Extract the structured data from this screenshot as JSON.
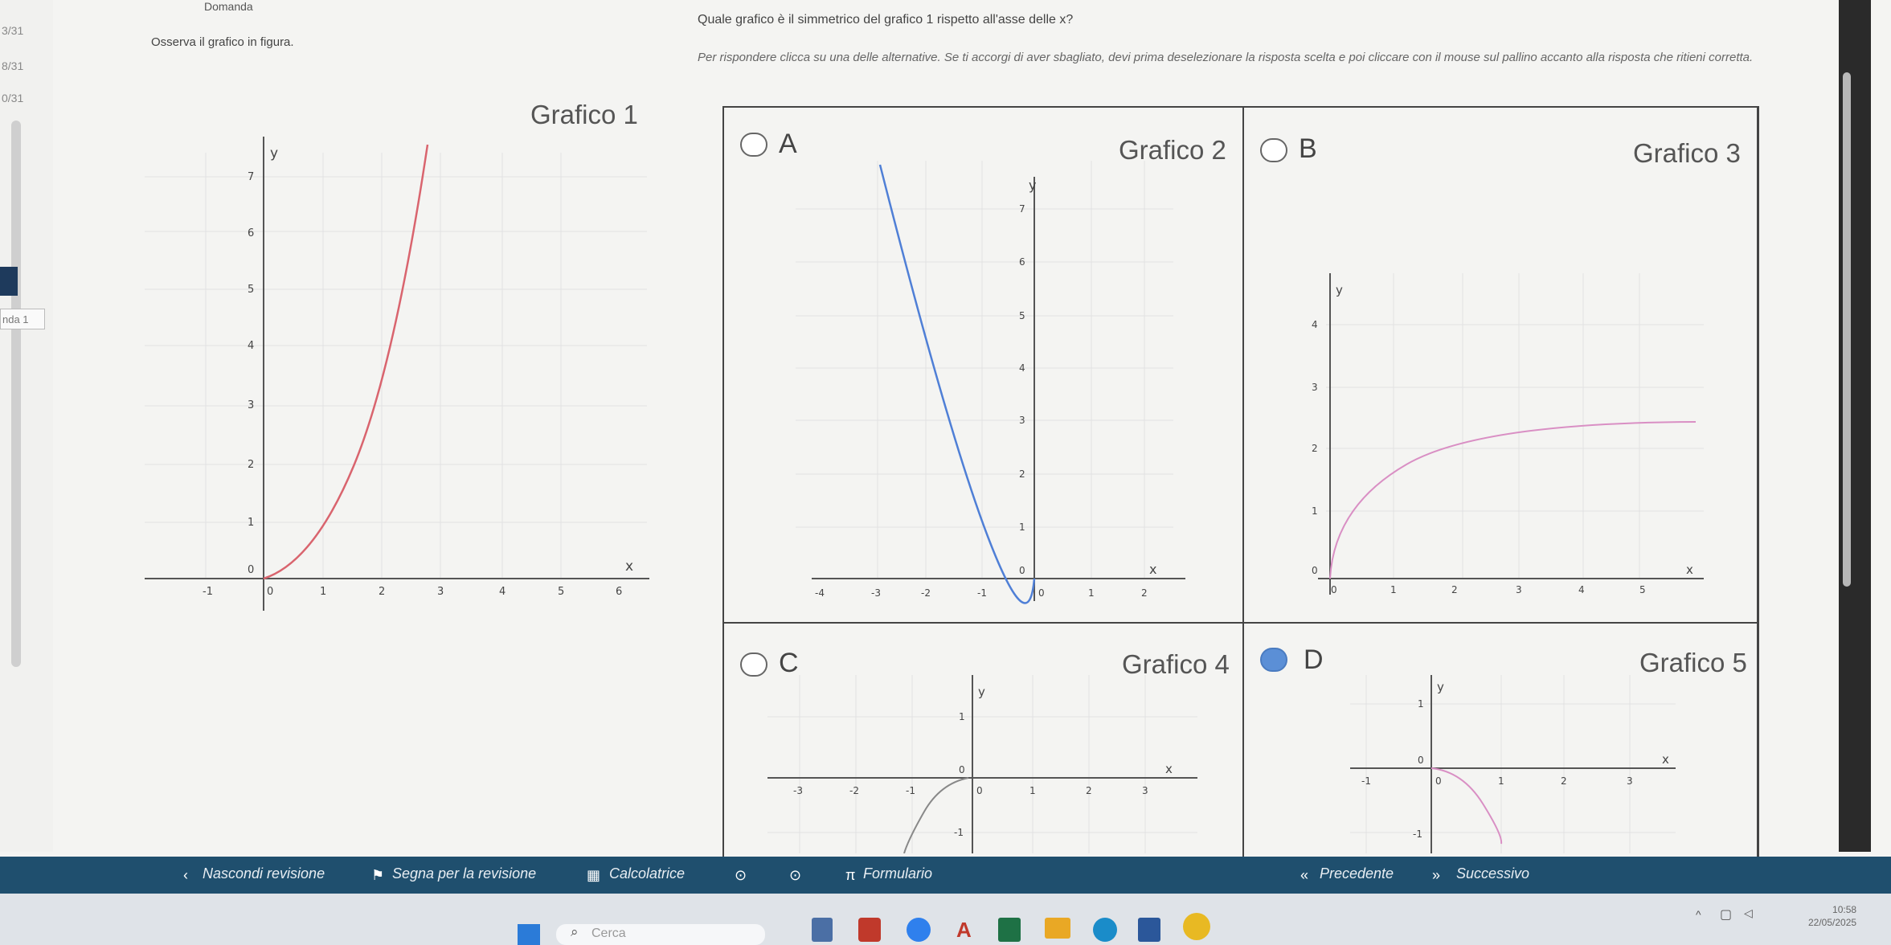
{
  "sidebar": {
    "counters": [
      "3/31",
      "8/31",
      "0/31"
    ],
    "side_label": "nda 1"
  },
  "header": {
    "label": "Domanda",
    "question": "Quale grafico è il simmetrico del grafico 1 rispetto all'asse delle x?",
    "instruction": "Per rispondere clicca su una delle alternative. Se ti accorgi di aver sbagliato, devi prima deselezionare la risposta scelta e poi cliccare con il mouse sul pallino accanto alla risposta che ritieni corretta.",
    "prompt": "Osserva il grafico in figura."
  },
  "figures": {
    "grafico1": "Grafico 1",
    "grafico2": "Grafico 2",
    "grafico3": "Grafico 3",
    "grafico4": "Grafico 4",
    "grafico5": "Grafico 5"
  },
  "options": [
    {
      "letter": "A",
      "selected": false
    },
    {
      "letter": "B",
      "selected": false
    },
    {
      "letter": "C",
      "selected": false
    },
    {
      "letter": "D",
      "selected": true
    }
  ],
  "axis": {
    "x": "x",
    "y": "y"
  },
  "ticks": {
    "g1_x": [
      "-1",
      "0",
      "1",
      "2",
      "3",
      "4",
      "5",
      "6"
    ],
    "g1_y": [
      "7",
      "6",
      "5",
      "4",
      "3",
      "2",
      "1",
      "0"
    ],
    "g2_x": [
      "-4",
      "-3",
      "-2",
      "-1",
      "0",
      "1",
      "2"
    ],
    "g2_y": [
      "7",
      "6",
      "5",
      "4",
      "3",
      "2",
      "1",
      "0"
    ],
    "g3_x": [
      "0",
      "1",
      "2",
      "3",
      "4",
      "5"
    ],
    "g3_y": [
      "4",
      "3",
      "2",
      "1",
      "0"
    ],
    "g4_x": [
      "-3",
      "-2",
      "-1",
      "0",
      "1",
      "2",
      "3"
    ],
    "g4_y": [
      "1",
      "0",
      "-1"
    ],
    "g5_x": [
      "-1",
      "0",
      "1",
      "2",
      "3"
    ],
    "g5_y": [
      "1",
      "0",
      "-1"
    ]
  },
  "toolbar": {
    "hide_review": "Nascondi revisione",
    "mark_review": "Segna per la revisione",
    "calculator": "Calcolatrice",
    "formulas": "Formulario",
    "previous": "Precedente",
    "next": "Successivo"
  },
  "taskbar": {
    "search_placeholder": "Cerca",
    "time": "10:58",
    "date": "22/05/2025"
  },
  "colors": {
    "curve_red": "#d9646e",
    "curve_blue": "#4f7fd6",
    "curve_pink": "#d98fc4",
    "curve_gray": "#888888",
    "toolbar_bg": "#1f4f6e",
    "selected_radio": "#5b8fd6"
  }
}
